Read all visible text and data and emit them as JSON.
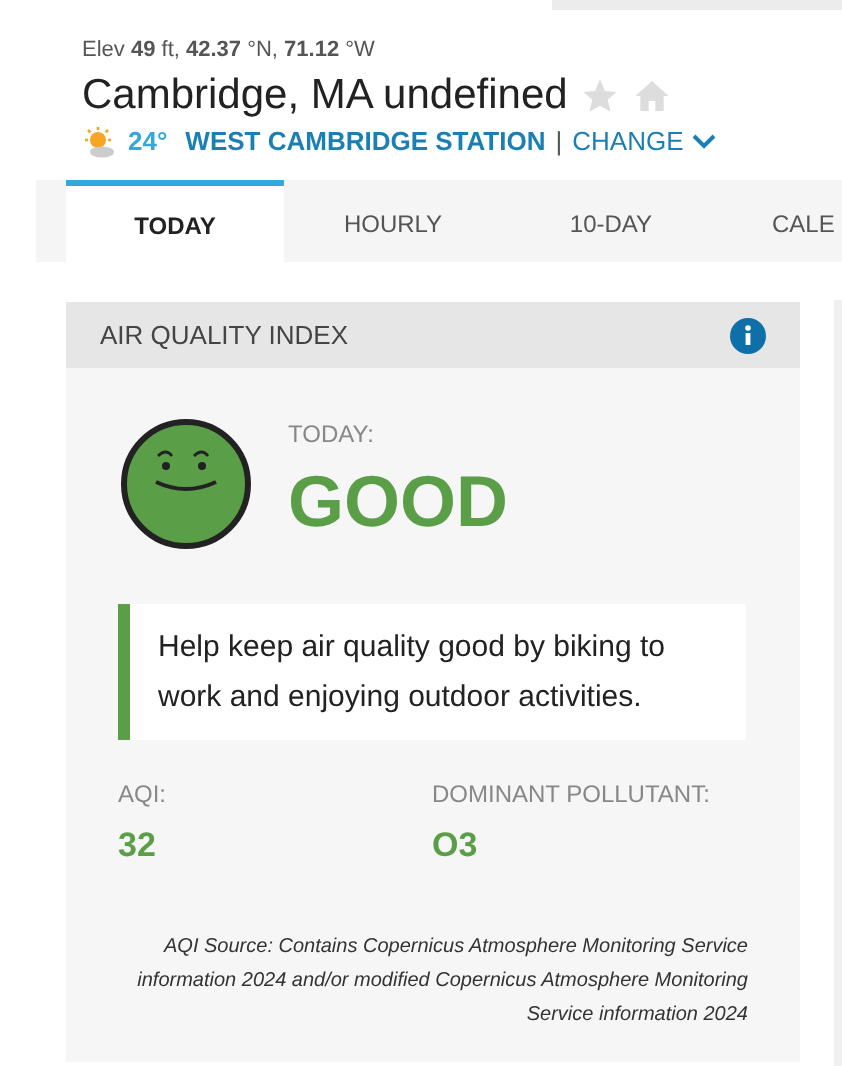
{
  "location": {
    "elevation": "Elev **49** ft, **42.37** °N, **71.12** °W",
    "name": "Cambridge, MA undefined",
    "favorite": false,
    "home": false,
    "temperature": "24°",
    "station": "WEST CAMBRIDGE STATION",
    "separator": "|",
    "change": "CHANGE"
  },
  "tabs": [
    {
      "label": "TODAY",
      "selected": true
    },
    {
      "label": "HOURLY",
      "selected": false
    },
    {
      "label": "10-DAY",
      "selected": false
    },
    {
      "label": "CALE",
      "selected": false
    }
  ],
  "card": {
    "title": "AIR QUALITY INDEX",
    "period": "TODAY:",
    "rating": "GOOD",
    "color": "#5a9e47",
    "tip": "Help keep air quality good by biking to work and enjoying outdoor activities.",
    "stats": [
      {
        "label": "AQI:",
        "value": "32"
      },
      {
        "label": "DOMINANT POLLUTANT:",
        "value": "O3"
      }
    ],
    "source": "AQI Source: Contains Copernicus Atmosphere Monitoring Service information 2024 and/or modified Copernicus Atmosphere Monitoring Service information 2024"
  }
}
